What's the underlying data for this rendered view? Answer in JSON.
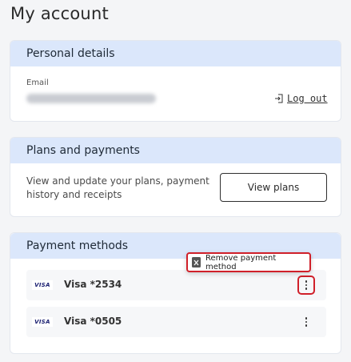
{
  "page": {
    "title": "My account"
  },
  "personal": {
    "header": "Personal details",
    "email_label": "Email",
    "logout_label": "Log out",
    "logout_icon": "logout-icon"
  },
  "plans": {
    "header": "Plans and payments",
    "description": "View and update your plans, payment history and receipts",
    "button_label": "View plans"
  },
  "payment": {
    "header": "Payment methods",
    "methods": [
      {
        "brand": "VISA",
        "label": "Visa *2534",
        "icon": "visa-icon",
        "menu_icon": "kebab-menu-icon"
      },
      {
        "brand": "VISA",
        "label": "Visa *0505",
        "icon": "visa-icon",
        "menu_icon": "kebab-menu-icon"
      }
    ],
    "menu": {
      "item_label": "Remove payment method",
      "item_icon": "trash-icon"
    }
  },
  "colors": {
    "header_bg": "#dbe7fb",
    "highlight": "#d0202a",
    "visa": "#1a1f71"
  }
}
